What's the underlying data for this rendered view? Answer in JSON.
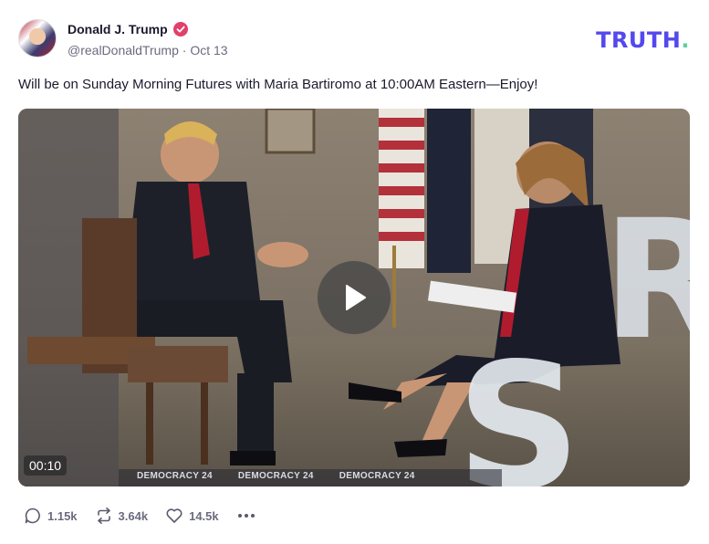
{
  "post": {
    "author_name": "Donald J. Trump",
    "handle": "@realDonaldTrump",
    "separator": "·",
    "date": "Oct 13",
    "text": "Will be on Sunday Morning Futures with Maria Bartiromo at 10:00AM Eastern—Enjoy!"
  },
  "brand": {
    "name": "TRUTH",
    "dot": "."
  },
  "video": {
    "duration": "00:10",
    "overlay_text": [
      "DEMOCRACY 24",
      "DEMOCRACY 24",
      "DEMOCRACY 24"
    ]
  },
  "actions": {
    "replies": "1.15k",
    "retruths": "3.64k",
    "likes": "14.5k"
  },
  "colors": {
    "brand": "#5448ee",
    "brand_dot": "#5bd1a0",
    "verified": "#e0406a",
    "meta": "#6b6b80"
  }
}
